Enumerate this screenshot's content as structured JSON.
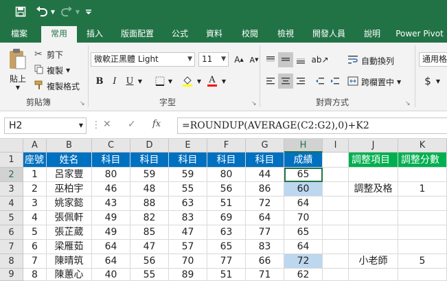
{
  "qat": {
    "save_icon": "save-icon",
    "undo_icon": "undo-icon",
    "redo_icon": "redo-icon",
    "customize_icon": "customize-icon"
  },
  "tabs": [
    "檔案",
    "常用",
    "插入",
    "版面配置",
    "公式",
    "資料",
    "校閱",
    "檢視",
    "開發人員",
    "說明",
    "Power Pivot"
  ],
  "active_tab": "常用",
  "clipboard": {
    "paste": "貼上",
    "cut": "剪下",
    "copy": "複製",
    "format_painter": "複製格式",
    "group": "剪貼簿"
  },
  "font": {
    "name": "微軟正黑體 Light",
    "size": "11",
    "bold": "B",
    "italic": "I",
    "underline": "U",
    "font_color_letter": "A",
    "group": "字型",
    "fill_color": "#ffff00",
    "font_color": "#ff0000"
  },
  "alignment": {
    "wrap": "自動換列",
    "merge": "跨欄置中",
    "group": "對齊方式"
  },
  "number": {
    "format": "通用格",
    "currency": "$"
  },
  "formula_bar": {
    "name_box": "H2",
    "cancel": "✕",
    "enter": "✓",
    "fx": "fx",
    "formula": "=ROUNDUP(AVERAGE(C2:G2),0)+K2"
  },
  "sheet": {
    "columns": [
      "A",
      "B",
      "C",
      "D",
      "E",
      "F",
      "G",
      "H",
      "I",
      "J",
      "K"
    ],
    "selected_column": "H",
    "selected_row": 2,
    "active_cell": "H2",
    "header_row": [
      "座號",
      "姓名",
      "科目",
      "科目",
      "科目",
      "科目",
      "科目",
      "成績",
      "",
      "調整項目",
      "調整分數"
    ],
    "rows": [
      [
        "1",
        "呂家豐",
        "80",
        "59",
        "59",
        "80",
        "44",
        "65",
        "",
        "",
        ""
      ],
      [
        "2",
        "巫柏宇",
        "46",
        "48",
        "55",
        "56",
        "86",
        "60",
        "",
        "調整及格",
        "1"
      ],
      [
        "3",
        "姚家懿",
        "43",
        "88",
        "63",
        "51",
        "72",
        "64",
        "",
        "",
        ""
      ],
      [
        "4",
        "張佩軒",
        "49",
        "82",
        "83",
        "69",
        "64",
        "70",
        "",
        "",
        ""
      ],
      [
        "5",
        "張芷葳",
        "49",
        "85",
        "47",
        "63",
        "77",
        "65",
        "",
        "",
        ""
      ],
      [
        "6",
        "梁雁茹",
        "64",
        "47",
        "57",
        "65",
        "83",
        "64",
        "",
        "",
        ""
      ],
      [
        "7",
        "陳晴筑",
        "64",
        "56",
        "70",
        "77",
        "66",
        "72",
        "",
        "小老師",
        "5"
      ],
      [
        "8",
        "陳蕙心",
        "40",
        "55",
        "89",
        "51",
        "71",
        "62",
        "",
        "",
        ""
      ]
    ],
    "highlighted_cells": [
      "H3",
      "H8"
    ],
    "colors": {
      "header_blue": "#0070c0",
      "header_green": "#00b050",
      "highlight": "#bdd7ee",
      "accent": "#217346"
    }
  }
}
